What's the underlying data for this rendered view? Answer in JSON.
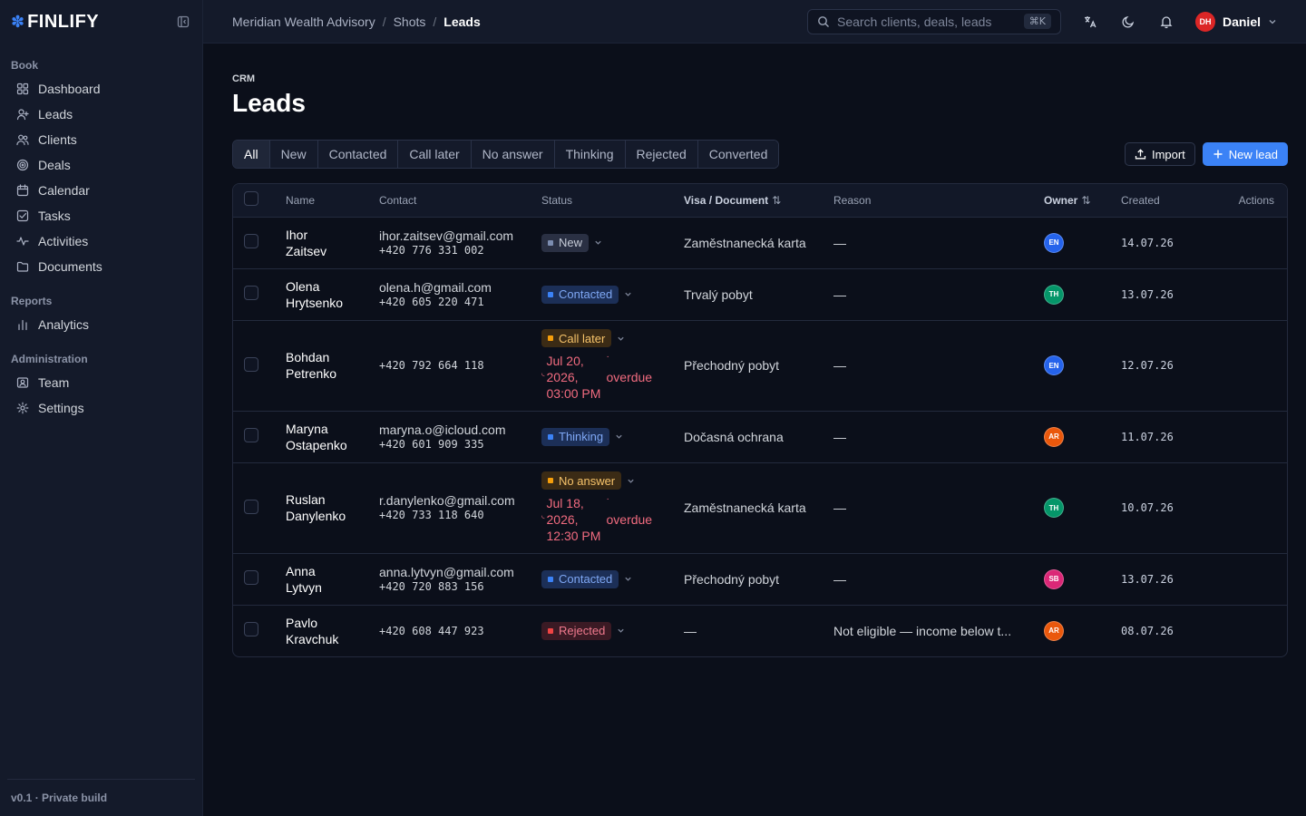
{
  "brand": {
    "name": "FINLIFY"
  },
  "sidebar": {
    "sections": [
      {
        "title": "Book",
        "items": [
          {
            "label": "Dashboard",
            "icon": "grid-icon"
          },
          {
            "label": "Leads",
            "icon": "user-plus-icon"
          },
          {
            "label": "Clients",
            "icon": "users-icon"
          },
          {
            "label": "Deals",
            "icon": "target-icon"
          },
          {
            "label": "Calendar",
            "icon": "calendar-icon"
          },
          {
            "label": "Tasks",
            "icon": "check-square-icon"
          },
          {
            "label": "Activities",
            "icon": "activity-icon"
          },
          {
            "label": "Documents",
            "icon": "folder-icon"
          }
        ]
      },
      {
        "title": "Reports",
        "items": [
          {
            "label": "Analytics",
            "icon": "bar-chart-icon"
          }
        ]
      },
      {
        "title": "Administration",
        "items": [
          {
            "label": "Team",
            "icon": "id-card-icon"
          },
          {
            "label": "Settings",
            "icon": "gear-icon"
          }
        ]
      }
    ],
    "footer": "v0.1 · Private build"
  },
  "topbar": {
    "breadcrumb": [
      "Meridian Wealth Advisory",
      "Shots",
      "Leads"
    ],
    "search_placeholder": "Search clients, deals, leads",
    "search_shortcut": "⌘K",
    "user": {
      "initials": "DH",
      "name": "Daniel"
    }
  },
  "page": {
    "eyebrow": "CRM",
    "title": "Leads",
    "tabs": [
      "All",
      "New",
      "Contacted",
      "Call later",
      "No answer",
      "Thinking",
      "Rejected",
      "Converted"
    ],
    "active_tab": "All",
    "import_label": "Import",
    "new_lead_label": "New lead"
  },
  "table": {
    "columns": {
      "name": "Name",
      "contact": "Contact",
      "status": "Status",
      "visa": "Visa / Document",
      "reason": "Reason",
      "owner": "Owner",
      "created": "Created",
      "actions": "Actions"
    },
    "rows": [
      {
        "first": "Ihor",
        "last": "Zaitsev",
        "email": "ihor.zaitsev@gmail.com",
        "phone": "+420 776 331 002",
        "status": "New",
        "status_kind": "new",
        "visa": "Zaměstnanecká karta",
        "reason": "—",
        "owner": "EN",
        "owner_color": "#2563eb",
        "created": "14.07.26"
      },
      {
        "first": "Olena",
        "last": "Hrytsenko",
        "email": "olena.h@gmail.com",
        "phone": "+420 605 220 471",
        "status": "Contacted",
        "status_kind": "blue",
        "visa": "Trvalý pobyt",
        "reason": "—",
        "owner": "TH",
        "owner_color": "#059669",
        "created": "13.07.26"
      },
      {
        "first": "Bohdan",
        "last": "Petrenko",
        "email": "",
        "phone": "+420 792 664 118",
        "status": "Call later",
        "status_kind": "orange",
        "due_date": "Jul 20, 2026, 03:00 PM",
        "due_note": "overdue",
        "visa": "Přechodný pobyt",
        "reason": "—",
        "owner": "EN",
        "owner_color": "#2563eb",
        "created": "12.07.26"
      },
      {
        "first": "Maryna",
        "last": "Ostapenko",
        "email": "maryna.o@icloud.com",
        "phone": "+420 601 909 335",
        "status": "Thinking",
        "status_kind": "blue",
        "visa": "Dočasná ochrana",
        "reason": "—",
        "owner": "AR",
        "owner_color": "#ea580c",
        "created": "11.07.26"
      },
      {
        "first": "Ruslan",
        "last": "Danylenko",
        "email": "r.danylenko@gmail.com",
        "phone": "+420 733 118 640",
        "status": "No answer",
        "status_kind": "orange",
        "due_date": "Jul 18, 2026, 12:30 PM",
        "due_note": "overdue",
        "visa": "Zaměstnanecká karta",
        "reason": "—",
        "owner": "TH",
        "owner_color": "#059669",
        "created": "10.07.26"
      },
      {
        "first": "Anna",
        "last": "Lytvyn",
        "email": "anna.lytvyn@gmail.com",
        "phone": "+420 720 883 156",
        "status": "Contacted",
        "status_kind": "blue",
        "visa": "Přechodný pobyt",
        "reason": "—",
        "owner": "SB",
        "owner_color": "#db2777",
        "created": "13.07.26"
      },
      {
        "first": "Pavlo",
        "last": "Kravchuk",
        "email": "",
        "phone": "+420 608 447 923",
        "status": "Rejected",
        "status_kind": "red",
        "visa": "—",
        "reason": "Not eligible — income below t...",
        "owner": "AR",
        "owner_color": "#ea580c",
        "created": "08.07.26"
      }
    ]
  }
}
